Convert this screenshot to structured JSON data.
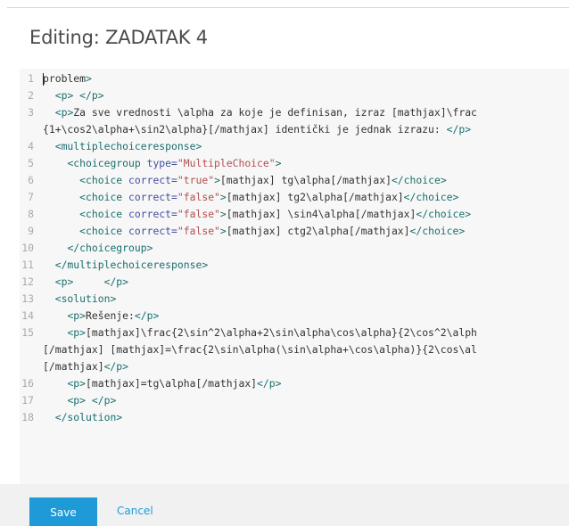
{
  "dialog": {
    "title": "Editing: ZADATAK 4"
  },
  "editor": {
    "lines": [
      {
        "num": "1",
        "text": "problem>"
      },
      {
        "num": "2",
        "text": "  <p> </p>"
      },
      {
        "num": "3",
        "text": "  <p>Za sve vrednosti \\alpha za koje je definisan, izraz [mathjax]\\frac"
      },
      {
        "num": "",
        "text": "{1+\\cos2\\alpha+\\sin2\\alpha}[/mathjax] identički je jednak izrazu: </p>"
      },
      {
        "num": "4",
        "text": "  <multiplechoiceresponse>"
      },
      {
        "num": "5",
        "text": "    <choicegroup type=\"MultipleChoice\">"
      },
      {
        "num": "6",
        "text": "      <choice correct=\"true\">[mathjax] tg\\alpha[/mathjax]</choice>"
      },
      {
        "num": "7",
        "text": "      <choice correct=\"false\">[mathjax] tg2\\alpha[/mathjax]</choice>"
      },
      {
        "num": "8",
        "text": "      <choice correct=\"false\">[mathjax] \\sin4\\alpha[/mathjax]</choice>"
      },
      {
        "num": "9",
        "text": "      <choice correct=\"false\">[mathjax] ctg2\\alpha[/mathjax]</choice>"
      },
      {
        "num": "10",
        "text": "    </choicegroup>"
      },
      {
        "num": "11",
        "text": "  </multiplechoiceresponse>"
      },
      {
        "num": "12",
        "text": "  <p>     </p>"
      },
      {
        "num": "13",
        "text": "  <solution>"
      },
      {
        "num": "14",
        "text": "    <p>Rešenje:</p>"
      },
      {
        "num": "15",
        "text": "    <p>[mathjax]\\frac{2\\sin^2\\alpha+2\\sin\\alpha\\cos\\alpha}{2\\cos^2\\alph"
      },
      {
        "num": "",
        "text": "[/mathjax] [mathjax]=\\frac{2\\sin\\alpha(\\sin\\alpha+\\cos\\alpha)}{2\\cos\\al"
      },
      {
        "num": "",
        "text": "[/mathjax]</p>"
      },
      {
        "num": "16",
        "text": "    <p>[mathjax]=tg\\alpha[/mathjax]</p>"
      },
      {
        "num": "17",
        "text": "    <p> </p>"
      },
      {
        "num": "18",
        "text": "  </solution>"
      }
    ]
  },
  "footer": {
    "save_label": "Save",
    "cancel_label": "Cancel"
  },
  "colors": {
    "accent": "#1e9bd7",
    "tag": "#1a6e6e",
    "attribute": "#3f4f9f",
    "string": "#b34d4d"
  }
}
